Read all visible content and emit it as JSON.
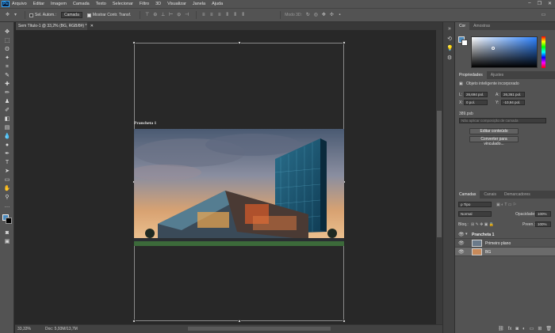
{
  "menubar": {
    "logo": "Ps",
    "items": [
      "Arquivo",
      "Editar",
      "Imagem",
      "Camada",
      "Texto",
      "Selecionar",
      "Filtro",
      "3D",
      "Visualizar",
      "Janela",
      "Ajuda"
    ]
  },
  "options": {
    "autoselect_label": "Sel. Autom.:",
    "autoselect_value": "Camada",
    "transform_label": "Mostrar Contr. Transf.",
    "mode3d_label": "Modo 3D:"
  },
  "document": {
    "tab_title": "Sem Título-1 @ 33,2% (BG, RGB/8#) *",
    "artboard_label": "Prancheta 1"
  },
  "status": {
    "zoom": "33,33%",
    "doc_info": "Doc: 5,93M/13,7M"
  },
  "color_panel": {
    "tabs": [
      "Cor",
      "Amostras"
    ]
  },
  "properties_panel": {
    "tabs": [
      "Propriedades",
      "Ajustes"
    ],
    "object_type": "Objeto inteligente incorporado",
    "l_label": "L:",
    "l_value": "26,694 pol.",
    "a_label": "A:",
    "a_value": "26,361 pol.",
    "x_label": "X:",
    "x_value": "0 pol.",
    "y_label": "Y:",
    "y_value": "-10,94 pol.",
    "filename": "389.psb",
    "comp_placeholder": "Não aplicar composição de camada",
    "edit_button": "Editar conteúdo",
    "convert_button": "Converter para vinculado..."
  },
  "layers_panel": {
    "tabs": [
      "Camadas",
      "Canais",
      "Demarcadores"
    ],
    "filter_label": "ρ Tipo",
    "blend_mode": "Normal",
    "opacity_label": "Opacidade:",
    "opacity_value": "100%",
    "lock_label": "Bloq.:",
    "fill_label": "Preen.:",
    "fill_value": "100%",
    "layers": [
      {
        "name": "Prancheta 1",
        "kind": "artboard"
      },
      {
        "name": "Primeiro plano",
        "kind": "layer"
      },
      {
        "name": "BG",
        "kind": "layer"
      }
    ]
  }
}
